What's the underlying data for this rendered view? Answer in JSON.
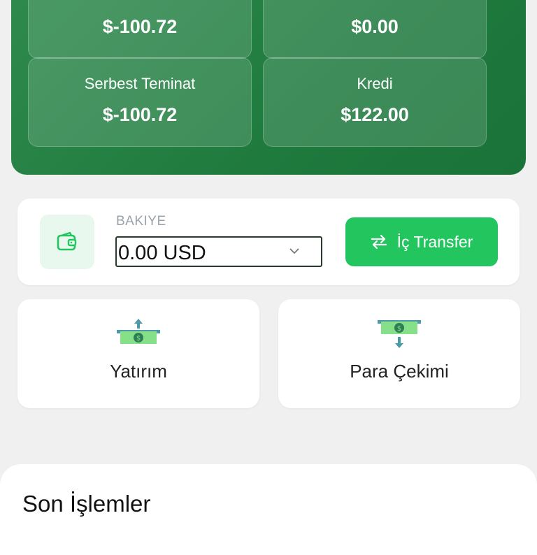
{
  "stats": {
    "card1": {
      "value": "$-100.72"
    },
    "card2": {
      "value": "$0.00"
    },
    "card3": {
      "label": "Serbest Teminat",
      "value": "$-100.72"
    },
    "card4": {
      "label": "Kredi",
      "value": "$122.00"
    }
  },
  "balance": {
    "label": "BAKIYE",
    "selected_value": "0.00 USD",
    "icon": "wallet-icon"
  },
  "transfer_button": {
    "label": "İç Transfer",
    "icon": "swap-arrows-icon"
  },
  "actions": {
    "deposit": {
      "label": "Yatırım",
      "icon": "deposit-money-icon"
    },
    "withdraw": {
      "label": "Para Çekimi",
      "icon": "withdraw-money-icon"
    }
  },
  "transactions": {
    "title": "Son İşlemler"
  },
  "colors": {
    "primary_green": "#1f7a3e",
    "accent_green": "#22c55e",
    "background": "#f0f0f0"
  }
}
